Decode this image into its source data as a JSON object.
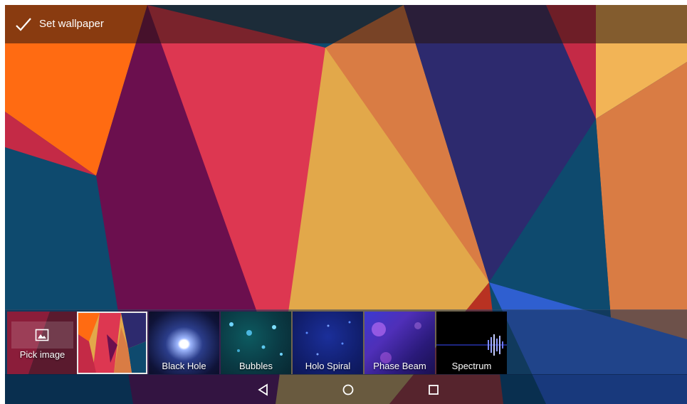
{
  "actionbar": {
    "title": "Set wallpaper",
    "icon": "check-icon"
  },
  "picker": {
    "tiles": [
      {
        "label": "Pick image",
        "icon": "image-icon"
      },
      {
        "label": "",
        "selected": true
      },
      {
        "label": "Black Hole"
      },
      {
        "label": "Bubbles"
      },
      {
        "label": "Holo Spiral"
      },
      {
        "label": "Phase Beam"
      },
      {
        "label": "Spectrum"
      }
    ]
  },
  "navbar": {
    "buttons": [
      "back-icon",
      "home-icon",
      "recents-icon"
    ]
  },
  "colors": {
    "crimson": "#dd3751",
    "plum": "#6b0f4e",
    "orange": "#ff6b12",
    "amber": "#e2a84a",
    "terracotta": "#d97c44",
    "indigo": "#2d2a6e",
    "navy": "#0e4a6e",
    "blue": "#2f5fd0"
  }
}
